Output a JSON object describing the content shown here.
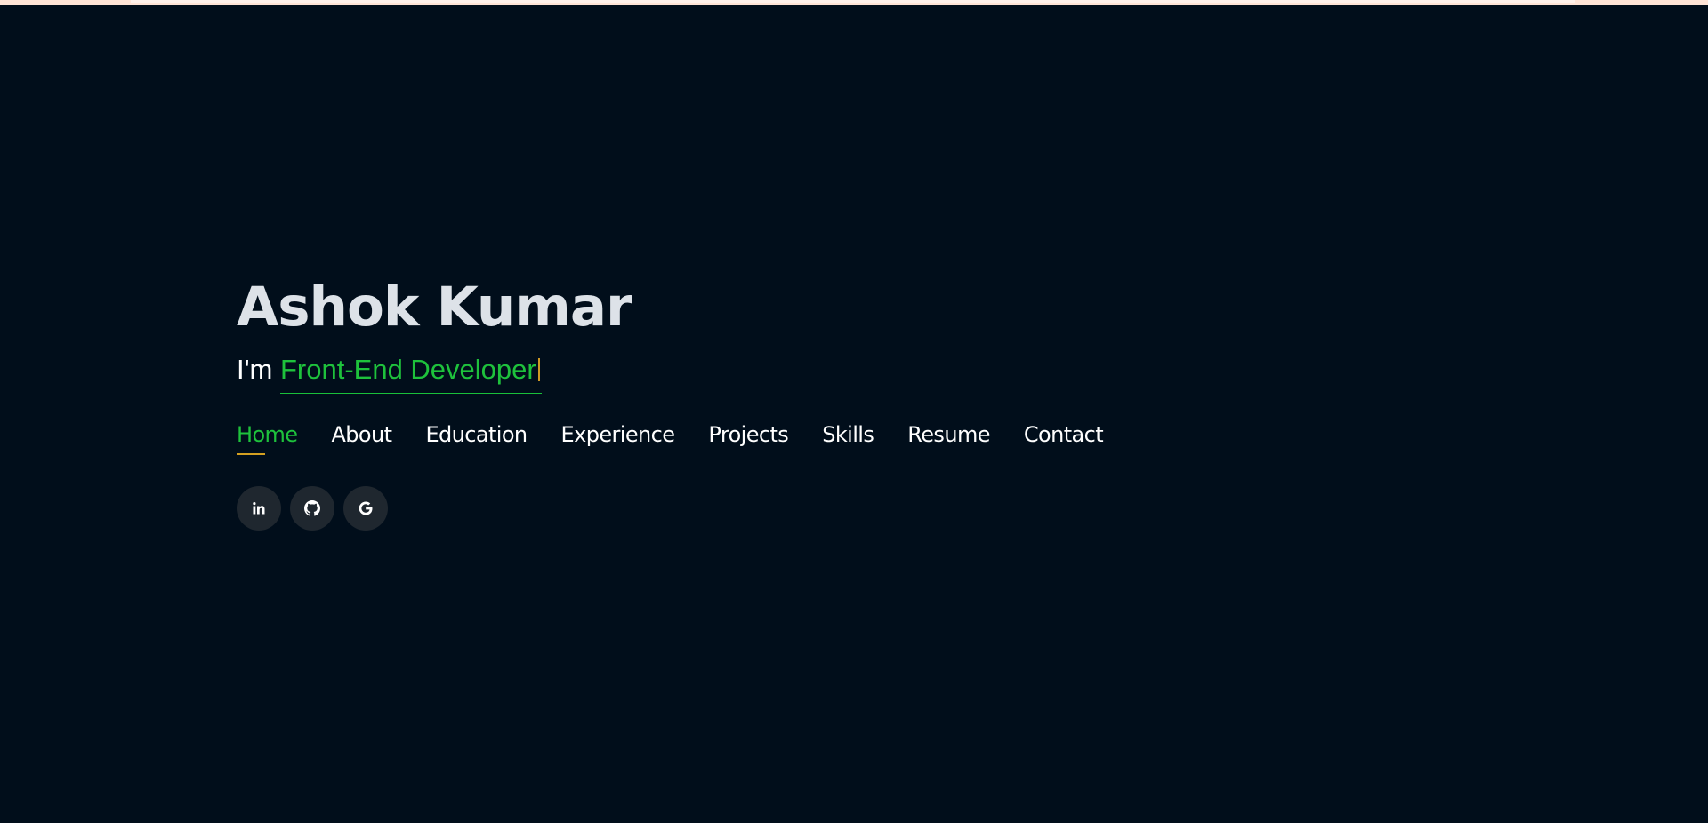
{
  "hero": {
    "name": "Ashok Kumar",
    "prefix": "I'm ",
    "role": "Front-End Developer"
  },
  "nav": {
    "items": [
      {
        "label": "Home",
        "active": true
      },
      {
        "label": "About"
      },
      {
        "label": "Education"
      },
      {
        "label": "Experience"
      },
      {
        "label": "Projects"
      },
      {
        "label": "Skills"
      },
      {
        "label": "Resume"
      },
      {
        "label": "Contact"
      }
    ]
  },
  "socials": [
    {
      "icon": "linkedin-icon"
    },
    {
      "icon": "github-icon"
    },
    {
      "icon": "google-icon"
    }
  ],
  "colors": {
    "background": "#010e1b",
    "accent_green": "#1ec23c",
    "accent_gold": "#d4a021",
    "social_bg": "#1f272f"
  }
}
